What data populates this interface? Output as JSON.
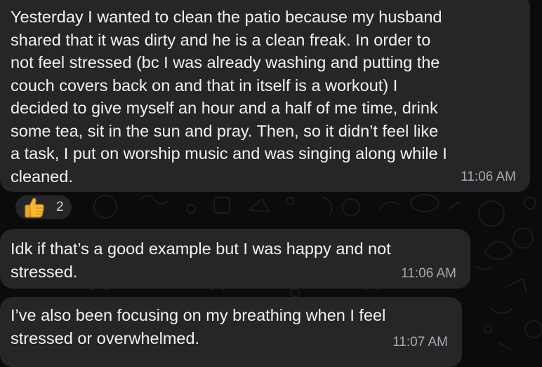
{
  "messages": [
    {
      "text": "Yesterday I wanted to clean the patio because my husband\nshared that it was dirty and he is a clean freak. In order to\nnot feel stressed (bc I was already washing and putting the\ncouch covers back on and that in itself is a workout) I\ndecided to give myself an hour and a half of me time, drink\nsome tea, sit in the sun and pray. Then, so it didn’t feel like\na task, I put on worship music and was singing along while I\ncleaned.",
      "time": "11:06 AM",
      "reaction": {
        "icon": "thumbs-up-icon",
        "count": "2"
      }
    },
    {
      "text": "Idk if that’s a good example but I was happy and not\nstressed.",
      "time": "11:06 AM"
    },
    {
      "text": "I’ve also been focusing on my breathing when I feel\nstressed or overwhelmed.",
      "time": "11:07 AM"
    }
  ],
  "colors": {
    "background": "#0b0b0b",
    "bubble": "#262628",
    "text": "#f2f2f2",
    "timestamp": "#a9a9ad"
  }
}
